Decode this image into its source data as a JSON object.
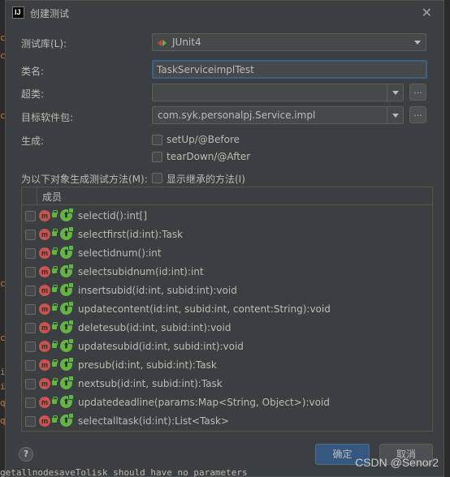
{
  "dialog": {
    "title": "创建测试",
    "close_symbol": "✕"
  },
  "form": {
    "testing_library": {
      "label": "测试库(L):",
      "value": "JUnit4"
    },
    "class_name": {
      "label": "类名:",
      "value": "TaskServiceimplTest"
    },
    "superclass": {
      "label": "超类:",
      "value": "",
      "browse_label": "..."
    },
    "destination_package": {
      "label": "目标软件包:",
      "value": "com.syk.personalpj.Service.impl",
      "browse_label": "..."
    },
    "generate": {
      "label": "生成:",
      "setup_label": "setUp/@Before",
      "teardown_label": "tearDown/@After"
    },
    "methods": {
      "label": "为以下对象生成测试方法(M):",
      "show_inherited_label": "显示继承的方法(I)"
    }
  },
  "members": {
    "header": "成员",
    "items": [
      "selectid():int[]",
      "selectfirst(id:int):Task",
      "selectidnum():int",
      "selectsubidnum(id:int):int",
      "insertsubid(id:int, subid:int):void",
      "updatecontent(id:int, subid:int, content:String):void",
      "deletesub(id:int, subid:int):void",
      "updatesubid(id:int, subid:int):void",
      "presub(id:int, subid:int):Task",
      "nextsub(id:int, subid:int):Task",
      "updatedeadline(params:Map<String, Object>):void",
      "selectalltask(id:int):List<Task>"
    ],
    "method_icon": "m",
    "override_icon": "⬆"
  },
  "footer": {
    "help_label": "?",
    "ok_label": "确定",
    "cancel_label": "取消"
  },
  "background": {
    "gutter": [
      "c",
      "c",
      "c",
      "c",
      "c",
      "i",
      "i",
      "q",
      "q"
    ],
    "code_line": "getallnodesaveTolisk should have no parameters"
  },
  "watermark": "CSDN @Senor2",
  "colors": {
    "dialog_bg": "#3c3f41",
    "field_bg": "#45494a",
    "focus_border": "#3d6185",
    "primary_button": "#365880",
    "method_icon": "#c75450",
    "override_icon": "#62b543"
  }
}
